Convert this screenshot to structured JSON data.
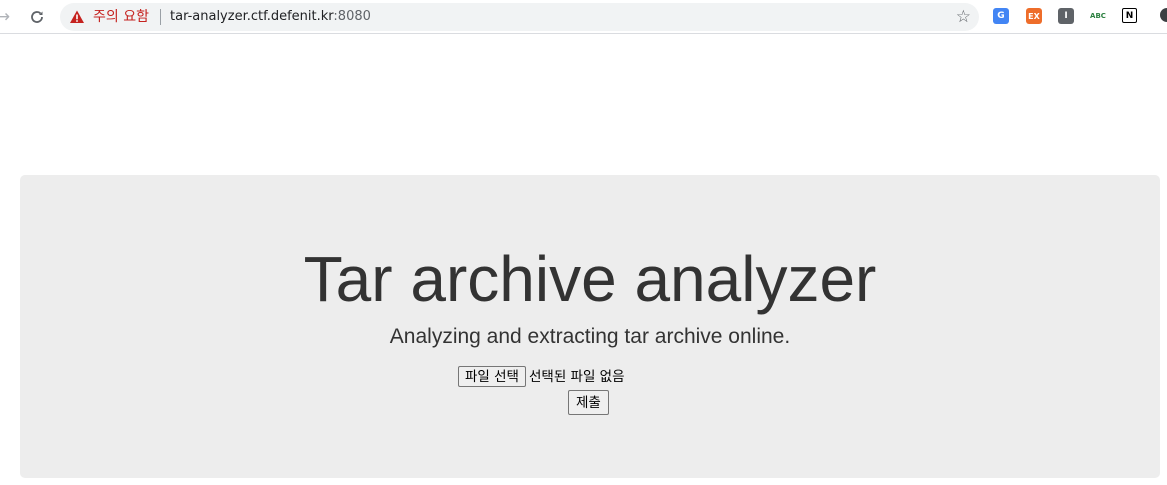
{
  "browser": {
    "back_icon": "arrow-right-icon",
    "reload_icon": "reload-icon",
    "security_warning": "주의 요함",
    "url_host": "tar-analyzer.ctf.defenit.kr",
    "url_port": ":8080",
    "bookmark_icon": "star-icon",
    "extensions": [
      {
        "name": "google-translate-icon",
        "glyph": "G"
      },
      {
        "name": "ex-extension-icon",
        "glyph": "EX"
      },
      {
        "name": "i-extension-icon",
        "glyph": "I"
      },
      {
        "name": "abc-spellcheck-icon",
        "glyph": "ABC"
      },
      {
        "name": "notion-icon",
        "glyph": "N"
      }
    ]
  },
  "page": {
    "title": "Tar archive analyzer",
    "subtitle": "Analyzing and extracting tar archive online.",
    "file_button_label": "파일 선택",
    "file_status": "선택된 파일 없음",
    "submit_label": "제출"
  },
  "colors": {
    "jumbotron_bg": "#ededed",
    "text": "#333333",
    "warning_red": "#c5221f"
  }
}
